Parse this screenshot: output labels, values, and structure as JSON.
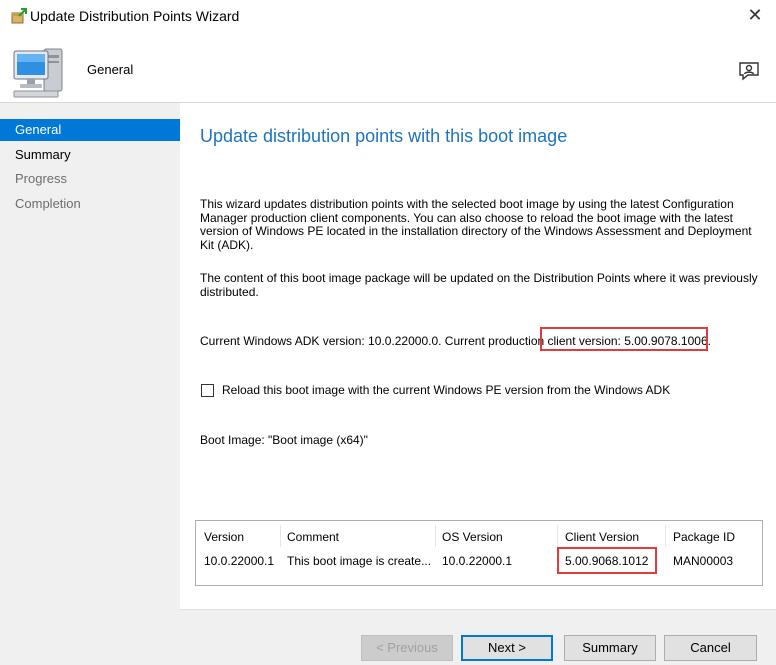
{
  "window": {
    "title": "Update Distribution Points Wizard",
    "close_glyph": "✕"
  },
  "header": {
    "title": "General"
  },
  "nav": {
    "items": [
      {
        "label": "General",
        "state": "active"
      },
      {
        "label": "Summary",
        "state": "enabled"
      },
      {
        "label": "Progress",
        "state": "disabled"
      },
      {
        "label": "Completion",
        "state": "disabled"
      }
    ]
  },
  "main": {
    "title": "Update distribution points with this boot image",
    "paragraph1": "This wizard updates distribution points with the selected boot image by using the latest Configuration Manager production client components. You can also choose to reload the boot image with the latest version of Windows PE located in the installation directory of the Windows Assessment and Deployment Kit (ADK).",
    "paragraph2": "The content of this boot image package will be updated on the Distribution Points where it was previously distributed.",
    "adk_line_prefix": "Current Windows ADK version: 10.0.22000.0. Current production ",
    "adk_line_highlight": "client version: 5.00.9078.1006.",
    "reload_checkbox_label": "Reload this boot image with the current Windows PE version from the Windows ADK",
    "reload_checked": false,
    "boot_image_line": "Boot Image: \"Boot image (x64)\""
  },
  "table": {
    "headers": [
      "Version",
      "Comment",
      "OS Version",
      "Client Version",
      "Package ID"
    ],
    "rows": [
      [
        "10.0.22000.1",
        "This boot image is create...",
        "10.0.22000.1",
        "5.00.9068.1012",
        "MAN00003"
      ]
    ]
  },
  "buttons": {
    "previous": "< Previous",
    "next": "Next >",
    "summary": "Summary",
    "cancel": "Cancel"
  },
  "colors": {
    "accent": "#0078d7",
    "title_blue": "#1e73be",
    "highlight_red": "#e03c3c"
  },
  "icons": {
    "title": "wizard-package-icon",
    "header": "computer-monitor-icon",
    "feedback": "feedback-person-icon"
  }
}
